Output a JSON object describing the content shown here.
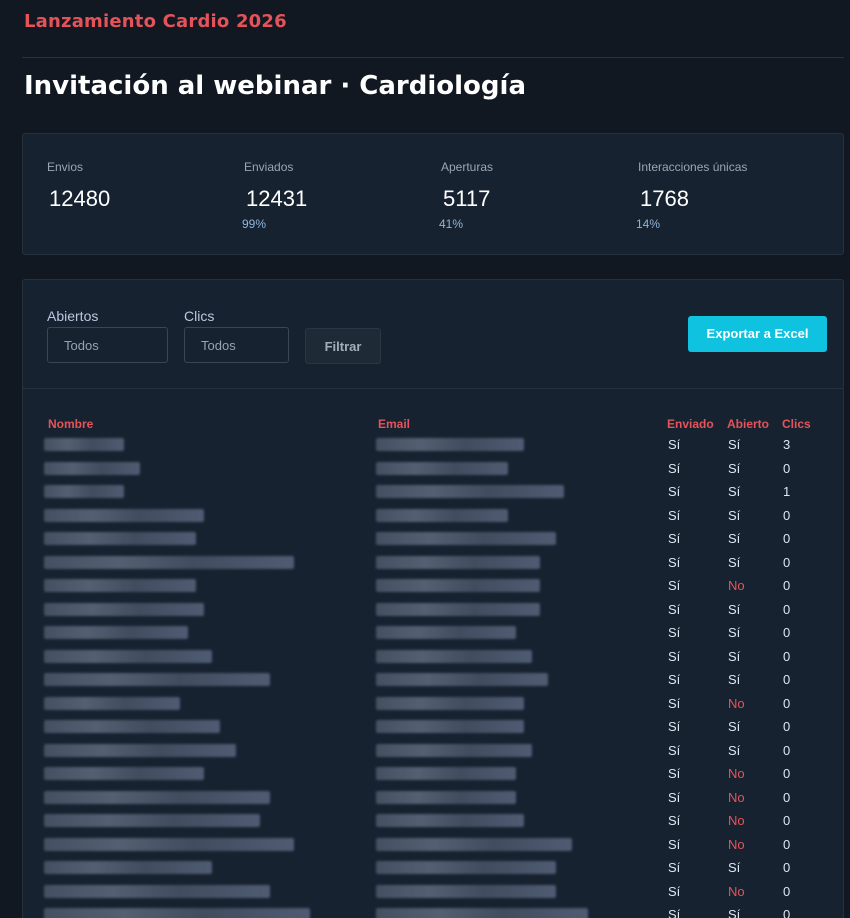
{
  "brand": "Lanzamiento Cardio 2026",
  "page_title": "Invitación al webinar · Cardiología",
  "stats": [
    {
      "label": "Envios",
      "value": "12480",
      "pct": ""
    },
    {
      "label": "Enviados",
      "value": "12431",
      "pct": "99%"
    },
    {
      "label": "Aperturas",
      "value": "5117",
      "pct": "41%"
    },
    {
      "label": "Interacciones únicas",
      "value": "1768",
      "pct": "14%"
    }
  ],
  "filters": {
    "opened_label": "Abiertos",
    "opened_value": "Todos",
    "clicks_label": "Clics",
    "clicks_value": "Todos",
    "filter_button": "Filtrar",
    "export_button": "Exportar a Excel"
  },
  "table": {
    "headers": {
      "name": "Nombre",
      "email": "Email",
      "sent": "Enviado",
      "opened": "Abierto",
      "clicks": "Clics"
    },
    "rows": [
      {
        "sent": "Sí",
        "opened": "Sí",
        "clicks": "3"
      },
      {
        "sent": "Sí",
        "opened": "Sí",
        "clicks": "0"
      },
      {
        "sent": "Sí",
        "opened": "Sí",
        "clicks": "1"
      },
      {
        "sent": "Sí",
        "opened": "Sí",
        "clicks": "0"
      },
      {
        "sent": "Sí",
        "opened": "Sí",
        "clicks": "0"
      },
      {
        "sent": "Sí",
        "opened": "Sí",
        "clicks": "0"
      },
      {
        "sent": "Sí",
        "opened": "No",
        "clicks": "0"
      },
      {
        "sent": "Sí",
        "opened": "Sí",
        "clicks": "0"
      },
      {
        "sent": "Sí",
        "opened": "Sí",
        "clicks": "0"
      },
      {
        "sent": "Sí",
        "opened": "Sí",
        "clicks": "0"
      },
      {
        "sent": "Sí",
        "opened": "Sí",
        "clicks": "0"
      },
      {
        "sent": "Sí",
        "opened": "No",
        "clicks": "0"
      },
      {
        "sent": "Sí",
        "opened": "Sí",
        "clicks": "0"
      },
      {
        "sent": "Sí",
        "opened": "Sí",
        "clicks": "0"
      },
      {
        "sent": "Sí",
        "opened": "No",
        "clicks": "0"
      },
      {
        "sent": "Sí",
        "opened": "No",
        "clicks": "0"
      },
      {
        "sent": "Sí",
        "opened": "No",
        "clicks": "0"
      },
      {
        "sent": "Sí",
        "opened": "No",
        "clicks": "0"
      },
      {
        "sent": "Sí",
        "opened": "Sí",
        "clicks": "0"
      },
      {
        "sent": "Sí",
        "opened": "No",
        "clicks": "0"
      },
      {
        "sent": "Sí",
        "opened": "Sí",
        "clicks": "0"
      }
    ]
  },
  "colors": {
    "accent": "#e5535a",
    "export": "#0fc2e0",
    "background": "#111821",
    "card": "#172230"
  }
}
